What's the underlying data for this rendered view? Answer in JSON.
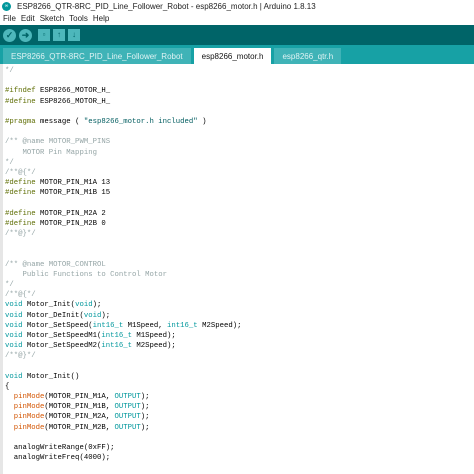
{
  "window": {
    "title": "ESP8266_QTR-8RC_PID_Line_Follower_Robot - esp8266_motor.h | Arduino 1.8.13",
    "app_icon": "arduino-logo-icon"
  },
  "menu": [
    "File",
    "Edit",
    "Sketch",
    "Tools",
    "Help"
  ],
  "toolbar": {
    "buttons": [
      {
        "name": "verify",
        "icon": "check-icon",
        "glyph": "✓"
      },
      {
        "name": "upload",
        "icon": "arrow-right-icon",
        "glyph": "➜"
      },
      {
        "name": "new",
        "icon": "new-file-icon",
        "glyph": "▫"
      },
      {
        "name": "open",
        "icon": "arrow-up-icon",
        "glyph": "↑"
      },
      {
        "name": "save",
        "icon": "arrow-down-icon",
        "glyph": "↓"
      }
    ]
  },
  "tabs": [
    {
      "label": "ESP8266_QTR-8RC_PID_Line_Follower_Robot",
      "active": false
    },
    {
      "label": "esp8266_motor.h",
      "active": true
    },
    {
      "label": "esp8266_qtr.h",
      "active": false
    }
  ],
  "colors": {
    "toolbar": "#006468",
    "tabbar": "#17a1a5",
    "comment": "#95a5a6",
    "preprocessor": "#5e6d03",
    "keyword": "#00979c",
    "function": "#d35400"
  },
  "code": [
    [
      [
        "c",
        "*/"
      ]
    ],
    [],
    [
      [
        "p",
        "#ifndef"
      ],
      [
        "n",
        " ESP8266_MOTOR_H_"
      ]
    ],
    [
      [
        "p",
        "#define"
      ],
      [
        "n",
        " ESP8266_MOTOR_H_"
      ]
    ],
    [],
    [
      [
        "p",
        "#pragma"
      ],
      [
        "n",
        " message ( "
      ],
      [
        "s",
        "\"esp8266_motor.h included\""
      ],
      [
        "n",
        " )"
      ]
    ],
    [],
    [
      [
        "c",
        "/** @name MOTOR_PWM_PINS"
      ]
    ],
    [
      [
        "c",
        "    MOTOR Pin Mapping"
      ]
    ],
    [
      [
        "c",
        "*/"
      ]
    ],
    [
      [
        "c",
        "/**@{*/"
      ]
    ],
    [
      [
        "p",
        "#define"
      ],
      [
        "n",
        " MOTOR_PIN_M1A 13"
      ]
    ],
    [
      [
        "p",
        "#define"
      ],
      [
        "n",
        " MOTOR_PIN_M1B 15"
      ]
    ],
    [],
    [
      [
        "p",
        "#define"
      ],
      [
        "n",
        " MOTOR_PIN_M2A 2"
      ]
    ],
    [
      [
        "p",
        "#define"
      ],
      [
        "n",
        " MOTOR_PIN_M2B 0"
      ]
    ],
    [
      [
        "c",
        "/**@}*/"
      ]
    ],
    [],
    [],
    [
      [
        "c",
        "/** @name MOTOR_CONTROL"
      ]
    ],
    [
      [
        "c",
        "    Public Functions to Control Motor"
      ]
    ],
    [
      [
        "c",
        "*/"
      ]
    ],
    [
      [
        "c",
        "/**@{*/"
      ]
    ],
    [
      [
        "k",
        "void"
      ],
      [
        "n",
        " Motor_Init("
      ],
      [
        "k",
        "void"
      ],
      [
        "n",
        ");"
      ]
    ],
    [
      [
        "k",
        "void"
      ],
      [
        "n",
        " Motor_DeInit("
      ],
      [
        "k",
        "void"
      ],
      [
        "n",
        ");"
      ]
    ],
    [
      [
        "k",
        "void"
      ],
      [
        "n",
        " Motor_SetSpeed("
      ],
      [
        "k",
        "int16_t"
      ],
      [
        "n",
        " M1Speed, "
      ],
      [
        "k",
        "int16_t"
      ],
      [
        "n",
        " M2Speed);"
      ]
    ],
    [
      [
        "k",
        "void"
      ],
      [
        "n",
        " Motor_SetSpeedM1("
      ],
      [
        "k",
        "int16_t"
      ],
      [
        "n",
        " M1Speed);"
      ]
    ],
    [
      [
        "k",
        "void"
      ],
      [
        "n",
        " Motor_SetSpeedM2("
      ],
      [
        "k",
        "int16_t"
      ],
      [
        "n",
        " M2Speed);"
      ]
    ],
    [
      [
        "c",
        "/**@}*/"
      ]
    ],
    [],
    [
      [
        "k",
        "void"
      ],
      [
        "n",
        " Motor_Init()"
      ]
    ],
    [
      [
        "n",
        "{"
      ]
    ],
    [
      [
        "n",
        "  "
      ],
      [
        "f",
        "pinMode"
      ],
      [
        "n",
        "(MOTOR_PIN_M1A, "
      ],
      [
        "t",
        "OUTPUT"
      ],
      [
        "n",
        ");"
      ]
    ],
    [
      [
        "n",
        "  "
      ],
      [
        "f",
        "pinMode"
      ],
      [
        "n",
        "(MOTOR_PIN_M1B, "
      ],
      [
        "t",
        "OUTPUT"
      ],
      [
        "n",
        ");"
      ]
    ],
    [
      [
        "n",
        "  "
      ],
      [
        "f",
        "pinMode"
      ],
      [
        "n",
        "(MOTOR_PIN_M2A, "
      ],
      [
        "t",
        "OUTPUT"
      ],
      [
        "n",
        ");"
      ]
    ],
    [
      [
        "n",
        "  "
      ],
      [
        "f",
        "pinMode"
      ],
      [
        "n",
        "(MOTOR_PIN_M2B, "
      ],
      [
        "t",
        "OUTPUT"
      ],
      [
        "n",
        ");"
      ]
    ],
    [],
    [
      [
        "n",
        "  analogWriteRange(0xFF);"
      ]
    ],
    [
      [
        "n",
        "  analogWriteFreq(4000);"
      ]
    ]
  ]
}
